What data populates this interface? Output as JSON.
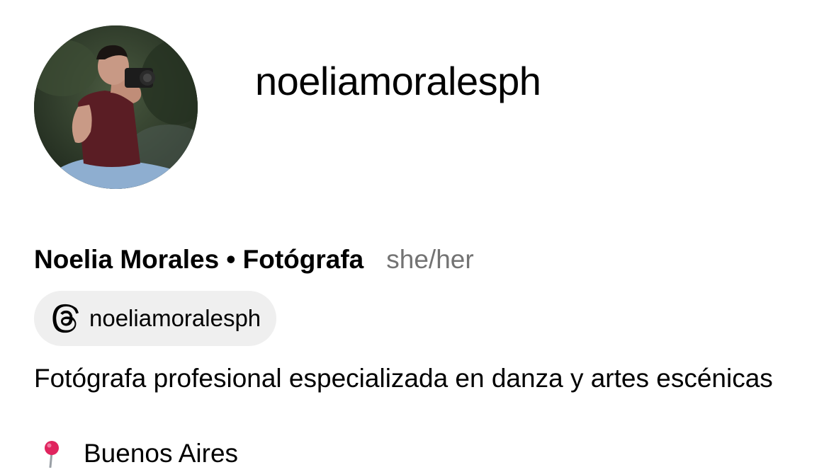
{
  "profile": {
    "username": "noeliamoralesph",
    "full_name": "Noelia Morales • Fotógrafa",
    "pronouns": "she/her",
    "threads": {
      "handle": "noeliamoralesph",
      "icon": "threads-icon"
    },
    "bio": "Fotógrafa profesional especializada en danza y artes escénicas",
    "location": {
      "icon": "pin-icon",
      "text": "Buenos Aires"
    },
    "avatar_icon": "avatar"
  },
  "colors": {
    "text": "#000000",
    "secondary_text": "#737373",
    "chip_background": "#efefef",
    "pin": "#e0245e"
  }
}
